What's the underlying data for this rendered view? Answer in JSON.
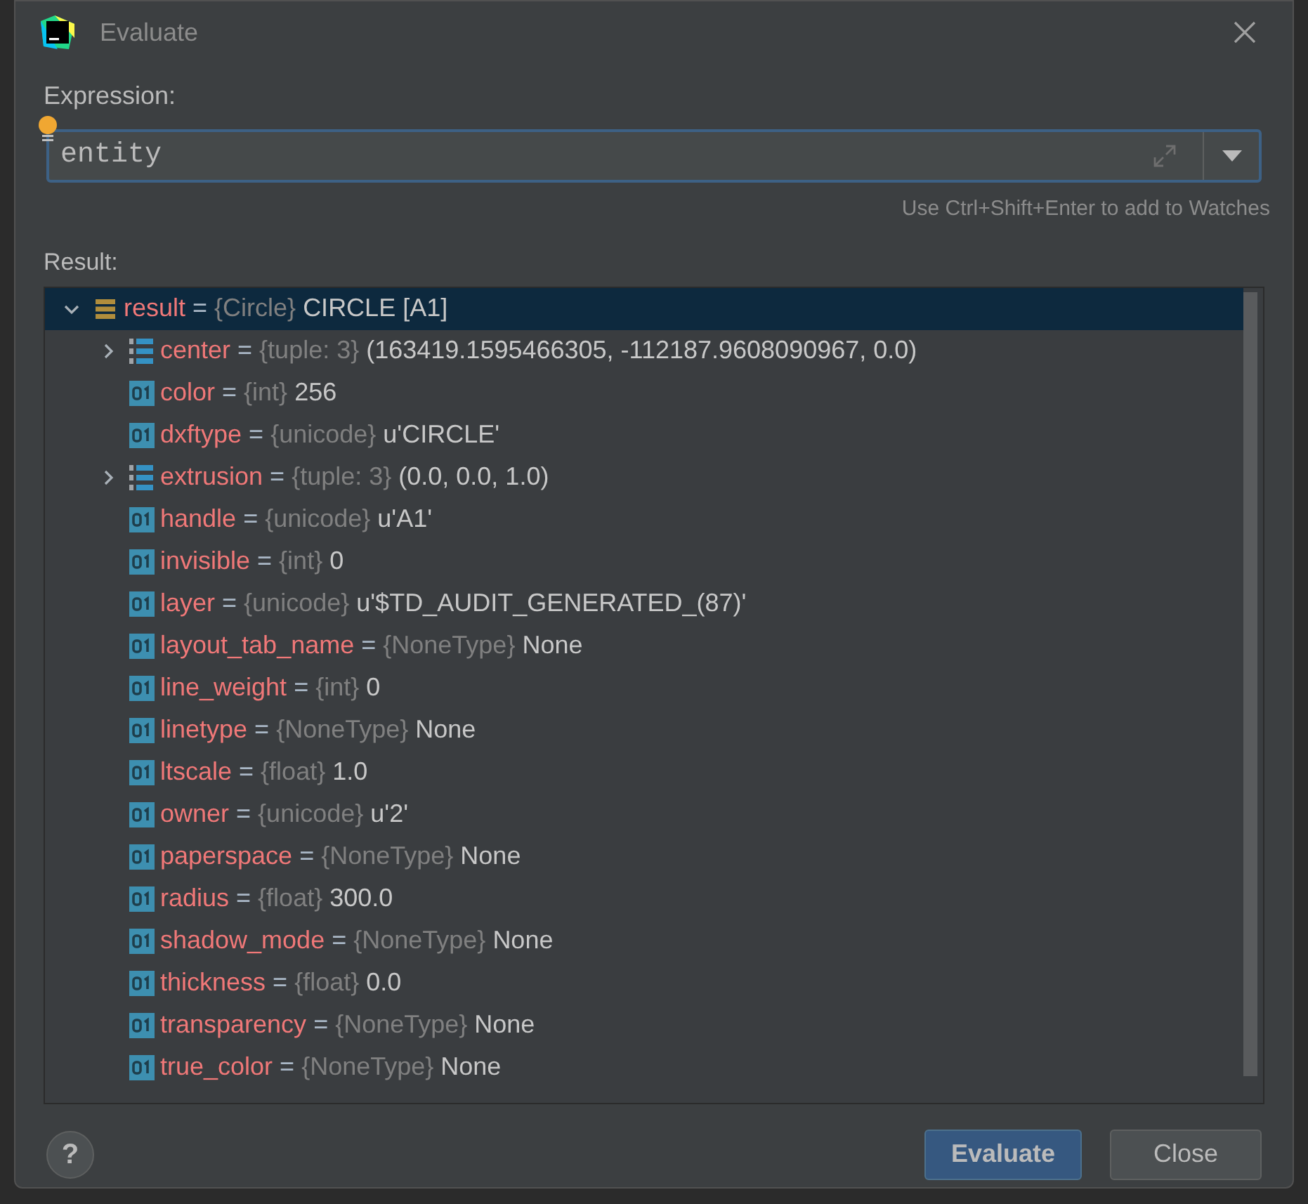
{
  "window": {
    "title": "Evaluate"
  },
  "expression": {
    "label": "Expression:",
    "value": "entity",
    "hint": "Use Ctrl+Shift+Enter to add to Watches"
  },
  "result": {
    "label": "Result:",
    "tree": [
      {
        "name": "result",
        "separator": "=",
        "type": "{Circle}",
        "value": "CIRCLE [A1]",
        "kind": "object",
        "expanded": true,
        "selected": true,
        "children": [
          {
            "name": "center",
            "separator": "=",
            "type": "{tuple: 3}",
            "value": "(163419.1595466305, -112187.9608090967, 0.0)",
            "kind": "tuple",
            "expanded": false,
            "selected": false
          },
          {
            "name": "color",
            "separator": "=",
            "type": "{int}",
            "value": "256",
            "kind": "primitive",
            "selected": false
          },
          {
            "name": "dxftype",
            "separator": "=",
            "type": "{unicode}",
            "value": "u'CIRCLE'",
            "kind": "primitive",
            "selected": false
          },
          {
            "name": "extrusion",
            "separator": "=",
            "type": "{tuple: 3}",
            "value": "(0.0, 0.0, 1.0)",
            "kind": "tuple",
            "expanded": false,
            "selected": false
          },
          {
            "name": "handle",
            "separator": "=",
            "type": "{unicode}",
            "value": "u'A1'",
            "kind": "primitive",
            "selected": false
          },
          {
            "name": "invisible",
            "separator": "=",
            "type": "{int}",
            "value": "0",
            "kind": "primitive",
            "selected": false
          },
          {
            "name": "layer",
            "separator": "=",
            "type": "{unicode}",
            "value": "u'$TD_AUDIT_GENERATED_(87)'",
            "kind": "primitive",
            "selected": false
          },
          {
            "name": "layout_tab_name",
            "separator": "=",
            "type": "{NoneType}",
            "value": "None",
            "kind": "primitive",
            "selected": false
          },
          {
            "name": "line_weight",
            "separator": "=",
            "type": "{int}",
            "value": "0",
            "kind": "primitive",
            "selected": false
          },
          {
            "name": "linetype",
            "separator": "=",
            "type": "{NoneType}",
            "value": "None",
            "kind": "primitive",
            "selected": false
          },
          {
            "name": "ltscale",
            "separator": "=",
            "type": "{float}",
            "value": "1.0",
            "kind": "primitive",
            "selected": false
          },
          {
            "name": "owner",
            "separator": "=",
            "type": "{unicode}",
            "value": "u'2'",
            "kind": "primitive",
            "selected": false
          },
          {
            "name": "paperspace",
            "separator": "=",
            "type": "{NoneType}",
            "value": "None",
            "kind": "primitive",
            "selected": false
          },
          {
            "name": "radius",
            "separator": "=",
            "type": "{float}",
            "value": "300.0",
            "kind": "primitive",
            "selected": false
          },
          {
            "name": "shadow_mode",
            "separator": "=",
            "type": "{NoneType}",
            "value": "None",
            "kind": "primitive",
            "selected": false
          },
          {
            "name": "thickness",
            "separator": "=",
            "type": "{float}",
            "value": "0.0",
            "kind": "primitive",
            "selected": false
          },
          {
            "name": "transparency",
            "separator": "=",
            "type": "{NoneType}",
            "value": "None",
            "kind": "primitive",
            "selected": false
          },
          {
            "name": "true_color",
            "separator": "=",
            "type": "{NoneType}",
            "value": "None",
            "kind": "primitive",
            "selected": false
          }
        ]
      }
    ]
  },
  "buttons": [
    {
      "label": "Evaluate",
      "kind": "primary"
    },
    {
      "label": "Close",
      "kind": "secondary"
    }
  ],
  "help": {
    "label": "?"
  }
}
